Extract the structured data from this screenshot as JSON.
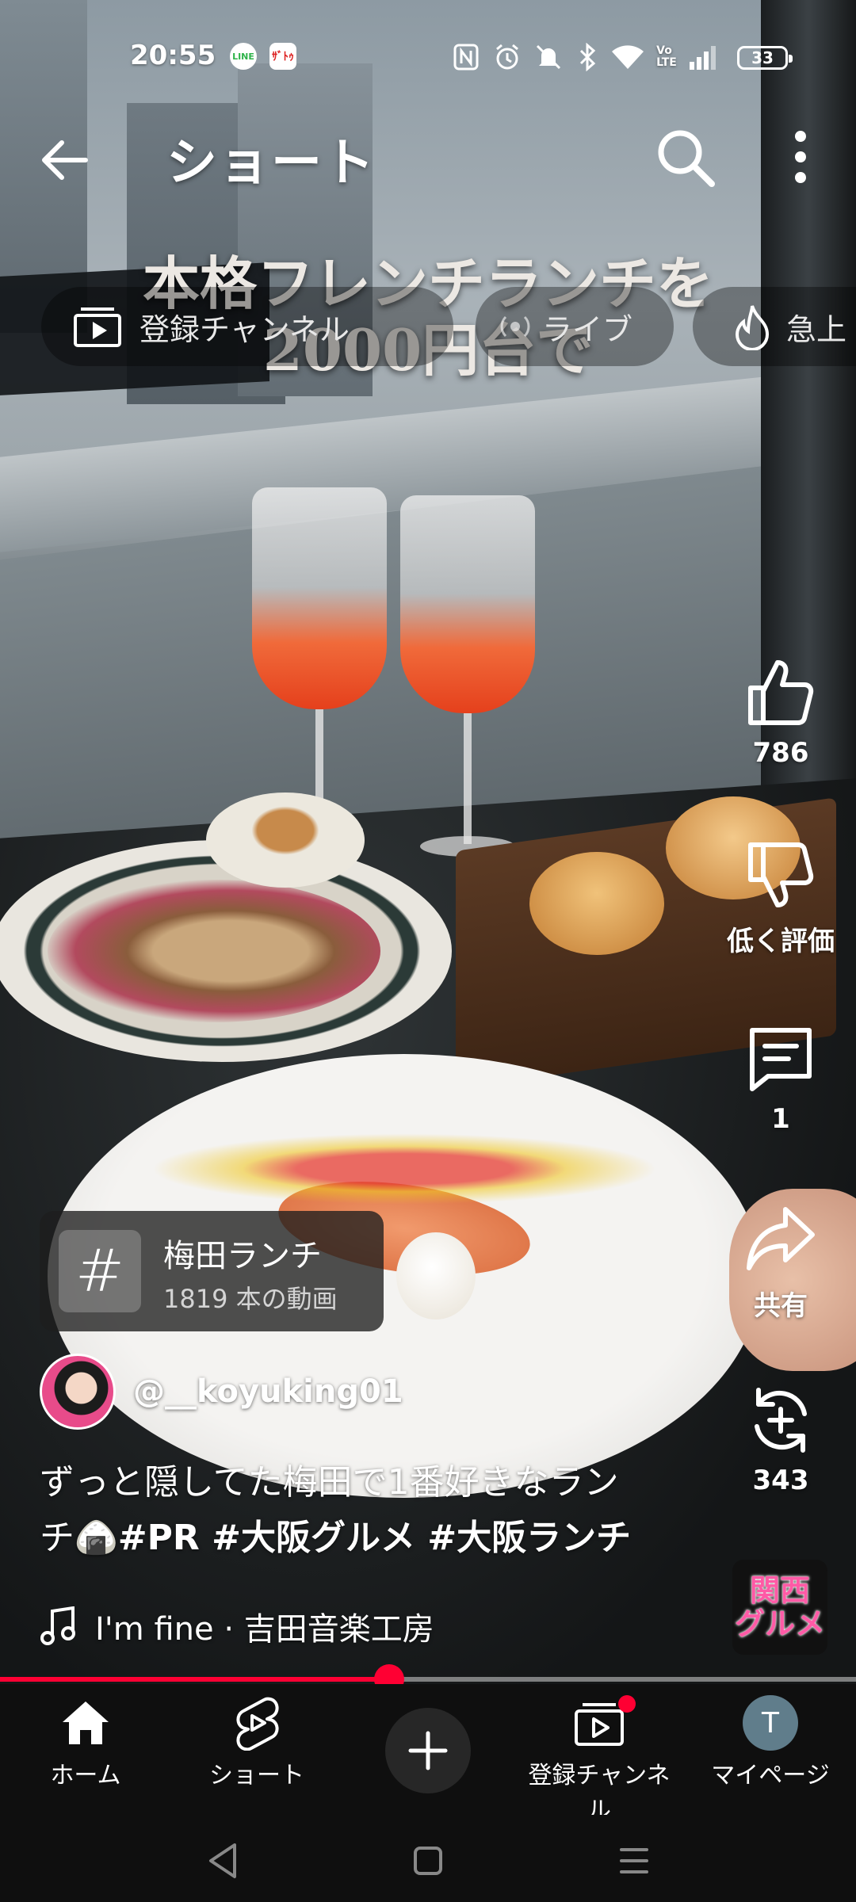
{
  "status_bar": {
    "time": "20:55",
    "notif_icons": [
      "line-icon",
      "app-badge-icon"
    ],
    "app_badge_label": "ｻﾞﾄｩ",
    "system_icons": [
      "nfc-icon",
      "alarm-icon",
      "mute-icon",
      "bluetooth-icon",
      "wifi-icon",
      "volte-icon",
      "signal-icon"
    ],
    "volte_label": "Vo\nLTE",
    "battery": "33"
  },
  "app_bar": {
    "title": "ショート",
    "back_icon": "arrow-back-icon",
    "search_icon": "search-icon",
    "more_icon": "more-vert-icon"
  },
  "chips": [
    {
      "label": "登録チャンネル",
      "icon": "subscriptions-icon"
    },
    {
      "label": "ライブ",
      "icon": "live-icon"
    },
    {
      "label": "急上",
      "icon": "trending-icon"
    }
  ],
  "video_overlay": {
    "line1": "本格フレンチランチを",
    "line2": "2000円台で"
  },
  "actions": {
    "like_count": "786",
    "dislike_label": "低く評価",
    "comments_count": "1",
    "share_label": "共有",
    "remix_count": "343"
  },
  "hashtag": {
    "symbol": "#",
    "name": "梅田ランチ",
    "count": "1819 本の動画"
  },
  "channel": {
    "handle": "@__koyuking01"
  },
  "caption": {
    "text_line1": "ずっと隠してた梅田で1番好きなラン",
    "text_line2_prefix": "チ",
    "emoji": "🍙",
    "tags": "#PR #大阪グルメ #大阪ランチ"
  },
  "music": {
    "title": "I'm fine · 吉田音楽工房"
  },
  "sound_thumb": {
    "line1": "関西",
    "line2": "グルメ"
  },
  "progress": {
    "fraction": 0.455
  },
  "bottom_nav": {
    "items": [
      {
        "label": "ホーム",
        "icon": "home-icon"
      },
      {
        "label": "ショート",
        "icon": "shorts-icon"
      },
      {
        "label": "",
        "icon": "add-icon"
      },
      {
        "label": "登録チャンネル",
        "icon": "subscriptions-icon"
      },
      {
        "label": "マイページ",
        "icon": "avatar-icon"
      }
    ],
    "avatar_initial": "T"
  },
  "colors": {
    "accent": "#ff0033",
    "nav_bg": "#0f0f0f"
  }
}
